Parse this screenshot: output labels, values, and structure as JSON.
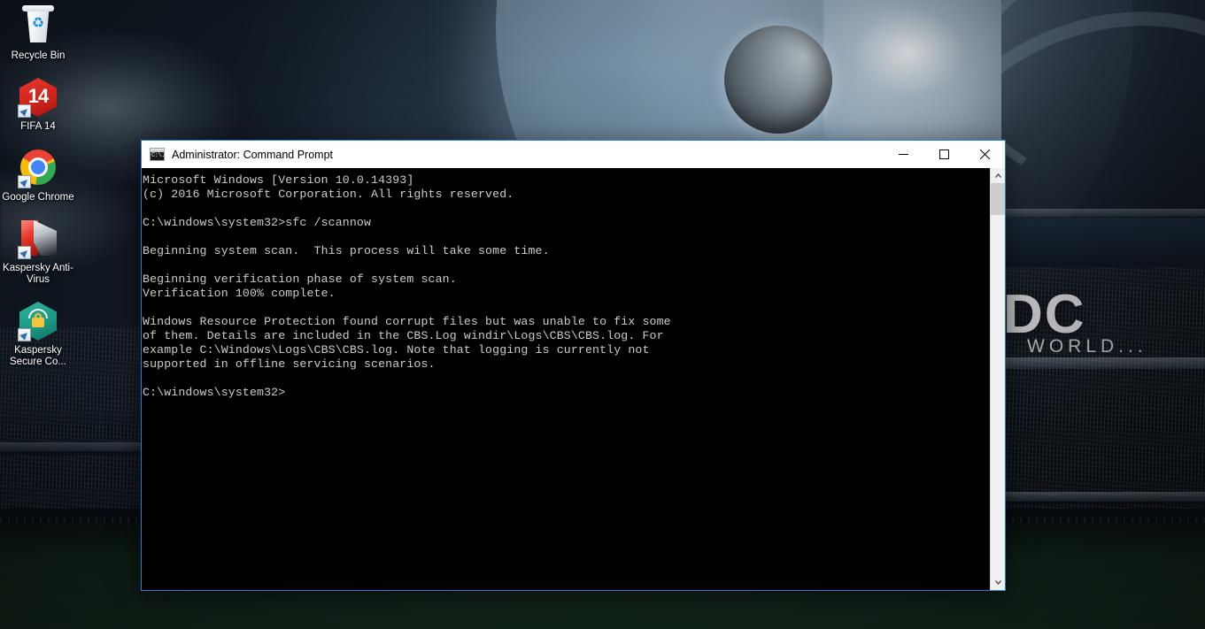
{
  "desktop": {
    "icons": [
      {
        "label": "Recycle Bin",
        "icon": "recycle-bin-icon"
      },
      {
        "label": "FIFA 14",
        "icon": "fifa-14-icon"
      },
      {
        "label": "Google Chrome",
        "icon": "google-chrome-icon"
      },
      {
        "label": "Kaspersky Anti-Virus",
        "icon": "kaspersky-antivirus-icon"
      },
      {
        "label": "Kaspersky Secure Co...",
        "icon": "kaspersky-secure-connection-icon"
      }
    ],
    "wallpaper": {
      "stadium_text_primary": "DC",
      "stadium_text_secondary": "WORLD..."
    }
  },
  "window": {
    "title": "Administrator: Command Prompt",
    "icon": "command-prompt-icon",
    "icon_text": "C:\\.",
    "controls": {
      "minimize": "minimize-button",
      "maximize": "maximize-button",
      "close": "close-button"
    },
    "accent_border": "#2b7cd3",
    "titlebar_bg": "#ffffff"
  },
  "console": {
    "background": "#000000",
    "foreground": "#cccccc",
    "lines": [
      "Microsoft Windows [Version 10.0.14393]",
      "(c) 2016 Microsoft Corporation. All rights reserved.",
      "",
      "C:\\windows\\system32>sfc /scannow",
      "",
      "Beginning system scan.  This process will take some time.",
      "",
      "Beginning verification phase of system scan.",
      "Verification 100% complete.",
      "",
      "Windows Resource Protection found corrupt files but was unable to fix some",
      "of them. Details are included in the CBS.Log windir\\Logs\\CBS\\CBS.log. For",
      "example C:\\Windows\\Logs\\CBS\\CBS.log. Note that logging is currently not",
      "supported in offline servicing scenarios.",
      "",
      "C:\\windows\\system32>"
    ],
    "command": "sfc /scannow",
    "prompt": "C:\\windows\\system32>"
  },
  "scrollbar": {
    "up_arrow": "▲",
    "down_arrow": "▼",
    "thumb_position_percent": 0
  }
}
